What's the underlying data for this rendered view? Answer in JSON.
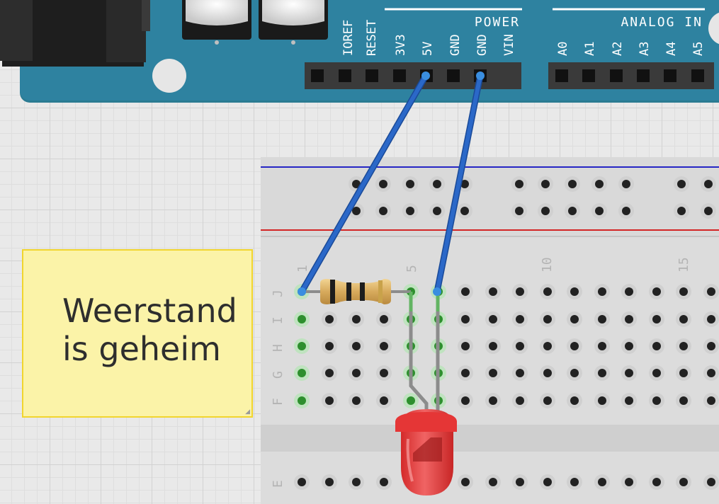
{
  "arduino": {
    "power_header": {
      "title": "POWER",
      "pins": [
        "IOREF",
        "RESET",
        "3V3",
        "5V",
        "GND",
        "GND",
        "VIN"
      ]
    },
    "analog_header": {
      "title": "ANALOG IN",
      "pins": [
        "A0",
        "A1",
        "A2",
        "A3",
        "A4",
        "A5"
      ]
    }
  },
  "breadboard": {
    "column_numbers": [
      "1",
      "5",
      "10",
      "15"
    ],
    "row_letters": [
      "J",
      "I",
      "H",
      "G",
      "F",
      "E"
    ]
  },
  "note": {
    "text": "Weerstand\nis geheim"
  },
  "colors": {
    "board": "#2b7b92",
    "wire": "#2b68c8",
    "led": "#e33434",
    "rail_plus": "#d32424",
    "rail_minus": "#2626c4"
  }
}
